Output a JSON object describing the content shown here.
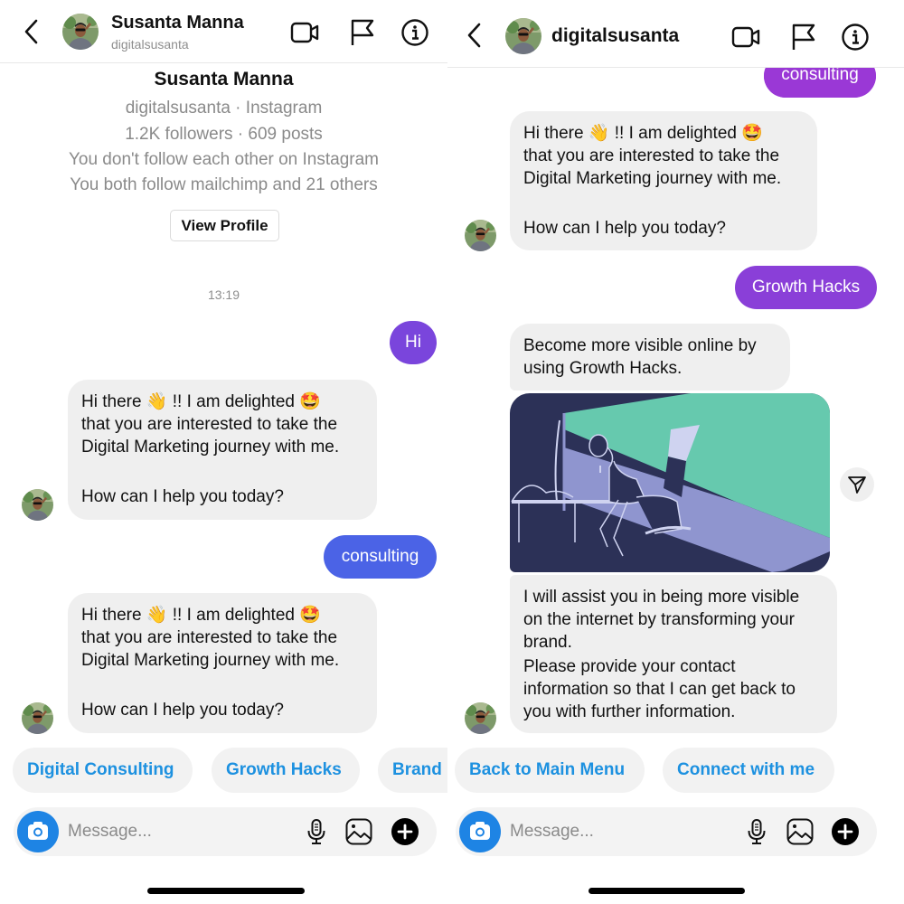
{
  "left_screen": {
    "header": {
      "name": "Susanta Manna",
      "username": "digitalsusanta",
      "icons": [
        "back-chevron-icon",
        "video-call-icon",
        "flag-icon",
        "info-icon"
      ]
    },
    "profile_card": {
      "name": "Susanta Manna",
      "handle_line": "digitalsusanta · Instagram",
      "stats_line": "1.2K followers · 609 posts",
      "follow_status": "You don't follow each other on Instagram",
      "mutuals": "You both follow mailchimp and 21 others",
      "view_profile_label": "View Profile"
    },
    "timestamp": "13:19",
    "messages": [
      {
        "from": "me",
        "text": "Hi",
        "color": "#7a45dc"
      },
      {
        "from": "them",
        "lines": [
          "Hi there",
          "!! I am delighted",
          "that you are interested to take the",
          "Digital Marketing journey with me.",
          "",
          "How can I help you today?"
        ],
        "emojis": [
          "👋",
          "🤩"
        ]
      },
      {
        "from": "me",
        "text": "consulting",
        "color": "#4b63e6"
      },
      {
        "from": "them",
        "lines": [
          "Hi there",
          "!! I am delighted",
          "that you are interested to take the",
          "Digital Marketing journey with me.",
          "",
          "How can I help you today?"
        ],
        "emojis": [
          "👋",
          "🤩"
        ]
      }
    ],
    "quick_replies": [
      "Digital Consulting",
      "Growth Hacks",
      "Brand"
    ],
    "composer": {
      "placeholder": "Message..."
    }
  },
  "right_screen": {
    "header": {
      "name": "digitalsusanta",
      "icons": [
        "back-chevron-icon",
        "video-call-icon",
        "flag-icon",
        "info-icon"
      ]
    },
    "messages": [
      {
        "from": "me",
        "text": "consulting",
        "color": "#9a38d6"
      },
      {
        "from": "them",
        "lines": [
          "Hi there",
          "!! I am delighted",
          "that you are interested to take the",
          "Digital Marketing journey with me.",
          "",
          "How can I help you today?"
        ],
        "emojis": [
          "👋",
          "🤩"
        ]
      },
      {
        "from": "me",
        "text": "Growth Hacks",
        "color": "#8a3fd8"
      },
      {
        "from": "them",
        "lines": [
          "Become more visible online by",
          "using Growth Hacks."
        ]
      },
      {
        "from": "them",
        "type": "image",
        "description": "illustration of person at computer desk"
      },
      {
        "from": "them",
        "lines": [
          "I will assist you in being more visible",
          "on the internet by transforming your",
          "brand.",
          "Please provide your contact",
          "information so that I can get back to",
          "you with further information."
        ]
      }
    ],
    "quick_replies": [
      "Back to Main Menu",
      "Connect with me"
    ],
    "composer": {
      "placeholder": "Message..."
    }
  },
  "colors": {
    "link_blue": "#1d91e0",
    "camera_blue": "#1e84e4",
    "incoming_bubble": "#efefef",
    "image_navy": "#2c3157",
    "image_green": "#66c9ae",
    "image_lavender": "#8f95cf"
  }
}
